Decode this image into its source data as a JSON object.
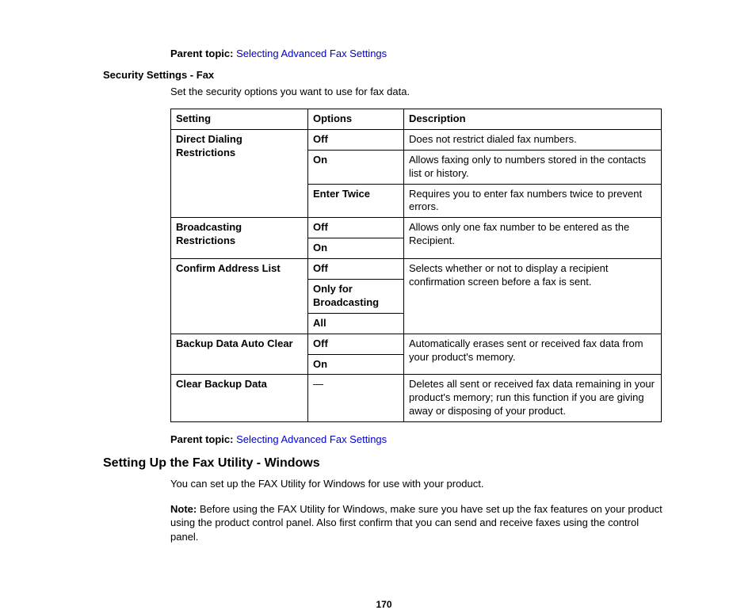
{
  "parent_topic_label": "Parent topic:",
  "parent_topic_link": "Selecting Advanced Fax Settings",
  "section_heading": "Security Settings - Fax",
  "section_intro": "Set the security options you want to use for fax data.",
  "table": {
    "headers": {
      "setting": "Setting",
      "options": "Options",
      "description": "Description"
    },
    "rows": {
      "direct_dialing": {
        "setting": "Direct Dialing Restrictions",
        "opts": {
          "off": "Off",
          "on": "On",
          "enter_twice": "Enter Twice"
        },
        "desc": {
          "off": "Does not restrict dialed fax numbers.",
          "on": "Allows faxing only to numbers stored in the contacts list or history.",
          "enter_twice": "Requires you to enter fax numbers twice to prevent errors."
        }
      },
      "broadcasting": {
        "setting": "Broadcasting Restrictions",
        "opts": {
          "off": "Off",
          "on": "On"
        },
        "desc": "Allows only one fax number to be entered as the Recipient."
      },
      "confirm": {
        "setting": "Confirm Address List",
        "opts": {
          "off": "Off",
          "only": "Only for Broadcasting",
          "all": "All"
        },
        "desc": "Selects whether or not to display a recipient confirmation screen before a fax is sent."
      },
      "backup_auto": {
        "setting": "Backup Data Auto Clear",
        "opts": {
          "off": "Off",
          "on": "On"
        },
        "desc": "Automatically erases sent or received fax data from your product's memory."
      },
      "clear_backup": {
        "setting": "Clear Backup Data",
        "opts": {
          "dash": "—"
        },
        "desc": "Deletes all sent or received fax data remaining in your product's memory; run this function if you are giving away or disposing of your product."
      }
    }
  },
  "h2": "Setting Up the Fax Utility - Windows",
  "para1": "You can set up the FAX Utility for Windows for use with your product.",
  "note_label": "Note:",
  "note_text": " Before using the FAX Utility for Windows, make sure you have set up the fax features on your product using the product control panel. Also first confirm that you can send and receive faxes using the control panel.",
  "page_number": "170"
}
